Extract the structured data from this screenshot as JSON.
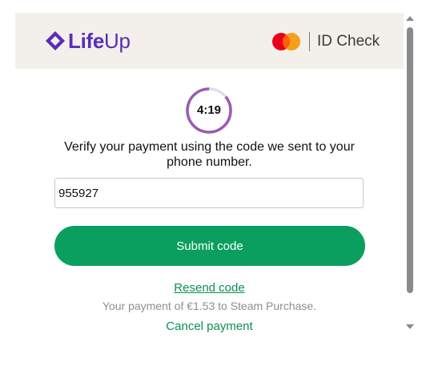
{
  "header": {
    "brand_prefix": "Life",
    "brand_suffix": "Up",
    "id_check_label": "ID Check",
    "brand_color": "#5b2db5",
    "background": "#f3f0eb"
  },
  "timer": {
    "label": "4:19",
    "ring_color": "#9b59b6",
    "remaining_fraction": 0.86
  },
  "verification": {
    "instruction": "Verify your payment using the code we sent to your phone number.",
    "code_value": "955927",
    "submit_label": "Submit code",
    "resend_label": "Resend code",
    "payment_text": "Your payment of €1.53 to Steam Purchase.",
    "cancel_label": "Cancel payment",
    "accent_color": "#0a9f5f"
  },
  "icons": {
    "brand": "lifeup-diamond-icon",
    "card_network": "mastercard-icon",
    "scroll_up": "scroll-up-arrow-icon",
    "scroll_down": "scroll-down-arrow-icon"
  }
}
